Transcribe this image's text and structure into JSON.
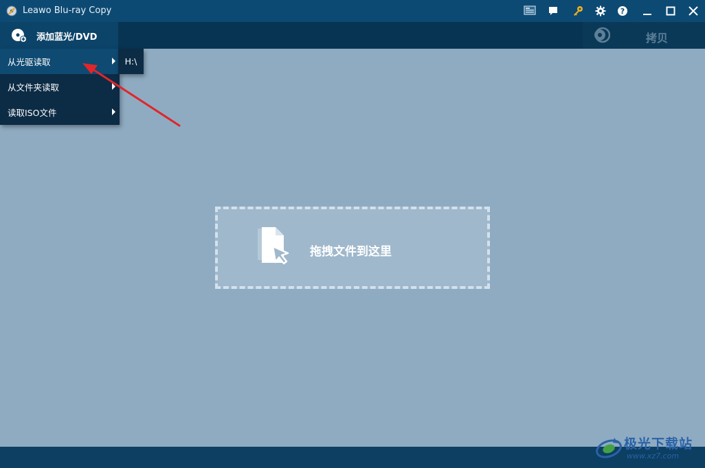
{
  "window": {
    "title": "Leawo Blu-ray Copy"
  },
  "titlebar_icons": [
    "monitor-icon",
    "chat-icon",
    "key-icon",
    "gear-icon",
    "help-icon",
    "minimize-icon",
    "maximize-icon",
    "close-icon"
  ],
  "toolbar": {
    "add_label": "添加蓝光/DVD",
    "copy_label": "拷贝"
  },
  "menu": {
    "items": [
      {
        "label": "从光驱读取",
        "active": true
      },
      {
        "label": "从文件夹读取",
        "active": false
      },
      {
        "label": "读取ISO文件",
        "active": false
      }
    ],
    "submenu_item": "H:\\"
  },
  "dropzone": {
    "label": "拖拽文件到这里"
  },
  "watermark": {
    "text_cn": "极光下载站",
    "text_url": "www.xz7.com"
  },
  "colors": {
    "titlebar": "#0d4a73",
    "toolbar": "#083453",
    "main_bg": "#8fabc1",
    "menu_bg": "#0c2b45",
    "menu_active": "#0f4a72",
    "annotation_arrow": "#e0262a"
  }
}
